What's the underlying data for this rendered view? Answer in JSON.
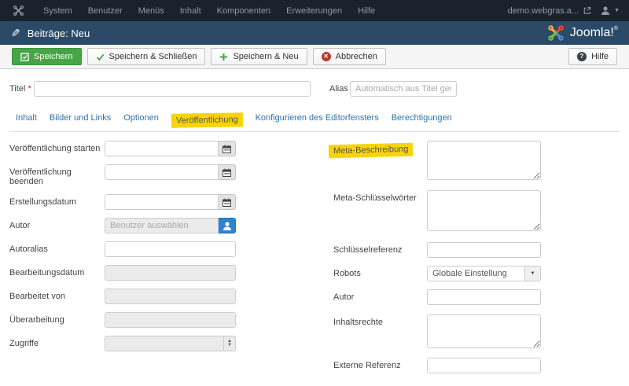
{
  "topbar": {
    "menus": [
      "System",
      "Benutzer",
      "Menüs",
      "Inhalt",
      "Komponenten",
      "Erweiterungen",
      "Hilfe"
    ],
    "site_name": "demo.webgras.a..."
  },
  "header": {
    "title": "Beiträge: Neu",
    "brand": "Joomla!",
    "brand_mark": "®"
  },
  "toolbar": {
    "save": "Speichern",
    "save_close": "Speichern & Schließen",
    "save_new": "Speichern & Neu",
    "cancel": "Abbrechen",
    "help": "Hilfe"
  },
  "form": {
    "title_label": "Titel",
    "required_mark": "*",
    "alias_label": "Alias",
    "alias_placeholder": "Automatisch aus Titel generieren"
  },
  "tabs": [
    {
      "label": "Inhalt"
    },
    {
      "label": "Bilder und Links"
    },
    {
      "label": "Optionen"
    },
    {
      "label": "Veröffentlichung",
      "active": true,
      "highlighted": true
    },
    {
      "label": "Konfigurieren des Editorfensters"
    },
    {
      "label": "Berechtigungen"
    }
  ],
  "left_fields": [
    {
      "label": "Veröffentlichung starten",
      "type": "text-with-calendar"
    },
    {
      "label": "Veröffentlichung beenden",
      "type": "text-with-calendar"
    },
    {
      "label": "Erstellungsdatum",
      "type": "text-with-calendar"
    },
    {
      "label": "Autor",
      "type": "user-picker",
      "placeholder": "Benutzer auswählen"
    },
    {
      "label": "Autoralias",
      "type": "text"
    },
    {
      "label": "Bearbeitungsdatum",
      "type": "text-disabled"
    },
    {
      "label": "Bearbeitet von",
      "type": "text-disabled"
    },
    {
      "label": "Überarbeitung",
      "type": "text-disabled"
    },
    {
      "label": "Zugriffe",
      "type": "number-spinner-disabled"
    }
  ],
  "right_fields": [
    {
      "label": "Meta-Beschreibung",
      "type": "textarea",
      "highlighted": true
    },
    {
      "label": "Meta-Schlüsselwörter",
      "type": "textarea"
    },
    {
      "label": "Schlüsselreferenz",
      "type": "text"
    },
    {
      "label": "Robots",
      "type": "select",
      "value": "Globale Einstellung"
    },
    {
      "label": "Autor",
      "type": "text"
    },
    {
      "label": "Inhaltsrechte",
      "type": "textarea"
    },
    {
      "label": "Externe Referenz",
      "type": "text"
    }
  ],
  "icons": {
    "pencil": "✎",
    "help_glyph": "?",
    "cancel_glyph": "✕",
    "spinner_up": "▲",
    "spinner_down": "▼",
    "caret_down": "▼",
    "topbar_caret": "▼"
  },
  "colors": {
    "topbar_bg": "#1a232c",
    "header_bg": "#2b4a68",
    "toolbar_bg": "#f5f5f5",
    "save_green": "#46a546",
    "user_button_blue": "#2a84d0",
    "cancel_red": "#b9382f",
    "link_blue": "#3071a9",
    "highlight_yellow": "#f5d50a"
  }
}
